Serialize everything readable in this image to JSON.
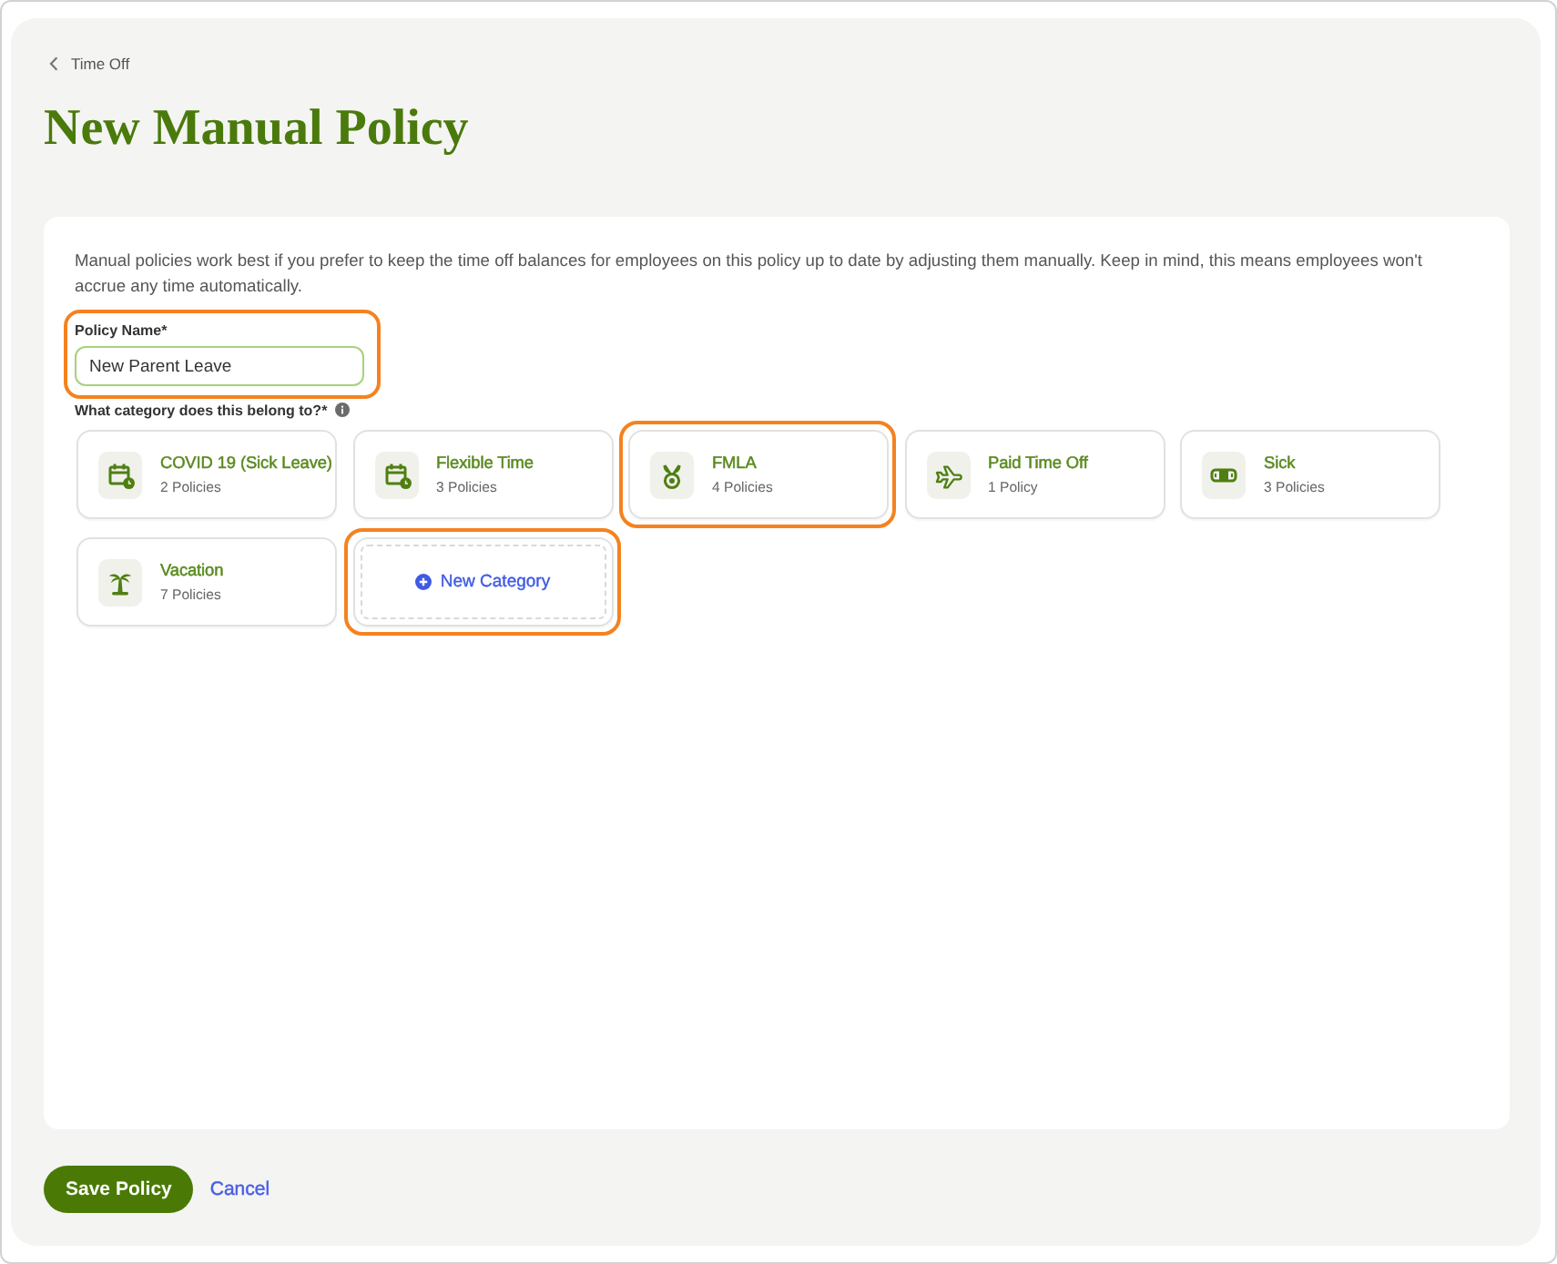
{
  "breadcrumb": {
    "label": "Time Off"
  },
  "title": "New Manual Policy",
  "description": "Manual policies work best if you prefer to keep the time off balances for employees on this policy up to date by adjusting them manually. Keep in mind, this means employees won't accrue any time automatically.",
  "policy_name": {
    "label": "Policy Name*",
    "value": "New Parent Leave",
    "highlighted": true
  },
  "category_question": "What category does this belong to?*",
  "categories": [
    {
      "kind": "category",
      "name": "COVID 19 (Sick Leave)",
      "count": "2 Policies",
      "selected": false,
      "highlighted": false
    },
    {
      "kind": "category",
      "name": "Flexible Time",
      "count": "3 Policies",
      "selected": false,
      "highlighted": false
    },
    {
      "kind": "category",
      "name": "FMLA",
      "count": "4 Policies",
      "selected": false,
      "highlighted": true
    },
    {
      "kind": "category",
      "name": "Paid Time Off",
      "count": "1 Policy",
      "selected": false,
      "highlighted": false
    },
    {
      "kind": "category",
      "name": "Sick",
      "count": "3 Policies",
      "selected": false,
      "highlighted": false
    },
    {
      "kind": "category",
      "name": "Vacation",
      "count": "7 Policies",
      "selected": false,
      "highlighted": false
    },
    {
      "kind": "add",
      "name": "New Category",
      "highlighted": true
    }
  ],
  "actions": {
    "save": "Save Policy",
    "cancel": "Cancel"
  }
}
